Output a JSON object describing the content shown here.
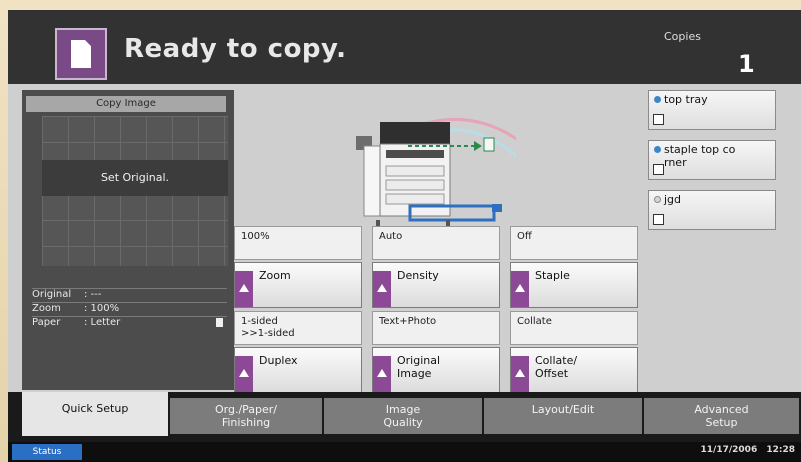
{
  "header": {
    "status": "Ready to copy.",
    "copies_label": "Copies",
    "copies_count": "1"
  },
  "preview": {
    "title": "Copy Image",
    "notice": "Set Original.",
    "original_label": "Original",
    "original_value": ": ---",
    "zoom_label": "Zoom",
    "zoom_value": ": 100%",
    "paper_label": "Paper",
    "paper_value": ": Letter"
  },
  "functions": [
    {
      "value": "100%",
      "label": "Zoom"
    },
    {
      "value": "Auto",
      "label": "Density"
    },
    {
      "value": "Off",
      "label": "Staple"
    },
    {
      "value": "1-sided\n>>1-sided",
      "label": "Duplex"
    },
    {
      "value": "Text+Photo",
      "label": "Original\nImage"
    },
    {
      "value": "Collate",
      "label": "Collate/\nOffset"
    }
  ],
  "destinations": [
    {
      "label": "top tray",
      "selected": true
    },
    {
      "label": "staple top co\nrner",
      "selected": true
    },
    {
      "label": "jgd",
      "selected": false
    }
  ],
  "tabs": [
    "Quick Setup",
    "Org./Paper/\nFinishing",
    "Image\nQuality",
    "Layout/Edit",
    "Advanced\nSetup"
  ],
  "footer": {
    "status_label": "Status",
    "date": "11/17/2006",
    "time": "12:28"
  },
  "colors": {
    "accent": "#8c4a96",
    "status_blue": "#2b6fc4"
  }
}
